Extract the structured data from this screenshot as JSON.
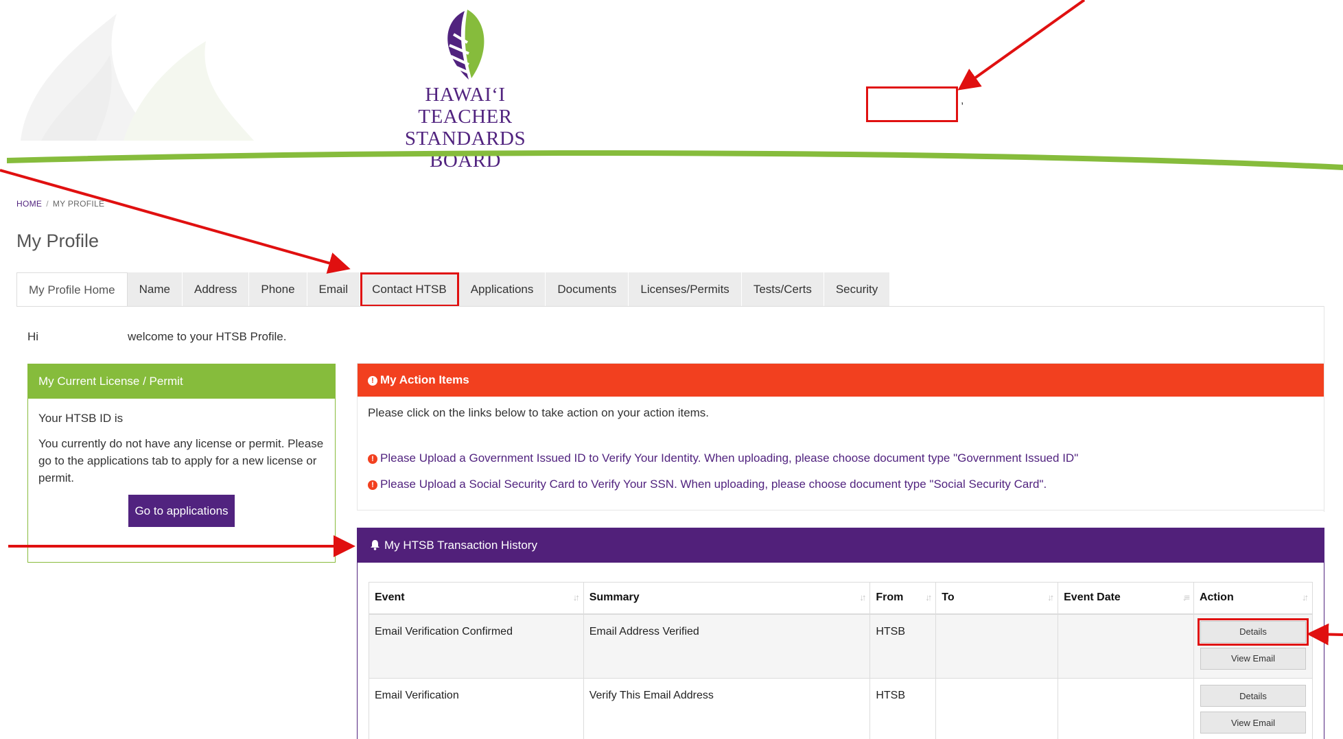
{
  "logo": {
    "line1": "HAWAIʻI TEACHER",
    "line2": "STANDARDS BOARD"
  },
  "breadcrumb": {
    "home": "HOME",
    "separator": "/",
    "current": "MY PROFILE"
  },
  "page_title": "My Profile",
  "tabs": [
    "My Profile Home",
    "Name",
    "Address",
    "Phone",
    "Email",
    "Contact HTSB",
    "Applications",
    "Documents",
    "Licenses/Permits",
    "Tests/Certs",
    "Security"
  ],
  "greeting": {
    "hi": "Hi",
    "welcome": "welcome to your HTSB Profile."
  },
  "license_panel": {
    "title": "My Current License / Permit",
    "id_text": "Your HTSB ID is",
    "message": "You currently do not have any license or permit. Please go to the applications tab to apply for a new license or permit.",
    "button": "Go to applications"
  },
  "action_items": {
    "title": "My Action Items",
    "intro": "Please click on the links below to take action on your action items.",
    "links": [
      "Please Upload a Government Issued ID to Verify Your Identity. When uploading, please choose document type \"Government Issued ID\"",
      "Please Upload a Social Security Card to Verify Your SSN. When uploading, please choose document type \"Social Security Card\"."
    ]
  },
  "history": {
    "title": "My HTSB Transaction History",
    "columns": [
      "Event",
      "Summary",
      "From",
      "To",
      "Event Date",
      "Action"
    ],
    "rows": [
      {
        "event": "Email Verification Confirmed",
        "summary": "Email Address Verified",
        "from": "HTSB",
        "to": "",
        "date": "",
        "buttons": [
          "Details",
          "View Email"
        ]
      },
      {
        "event": "Email Verification",
        "summary": "Verify This Email Address",
        "from": "HTSB",
        "to": "",
        "date": "",
        "buttons": [
          "Details",
          "View Email"
        ]
      }
    ]
  },
  "colors": {
    "brand_purple": "#51237f",
    "brand_green": "#86bc3c",
    "alert_orange": "#f2401f",
    "annotation_red": "#e01010"
  }
}
